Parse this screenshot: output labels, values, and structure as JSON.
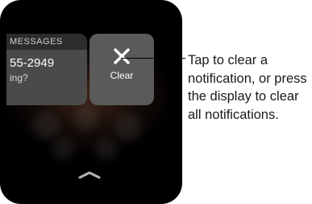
{
  "notification": {
    "app": "MESSAGES",
    "line1": "55-2949",
    "line2": "ing?"
  },
  "clear_button": {
    "label": "Clear",
    "icon": "close-icon"
  },
  "dismiss_handle": {
    "icon": "chevron-up-icon"
  },
  "callout": {
    "text": "Tap to clear a notification, or press the display to clear all notifications."
  }
}
